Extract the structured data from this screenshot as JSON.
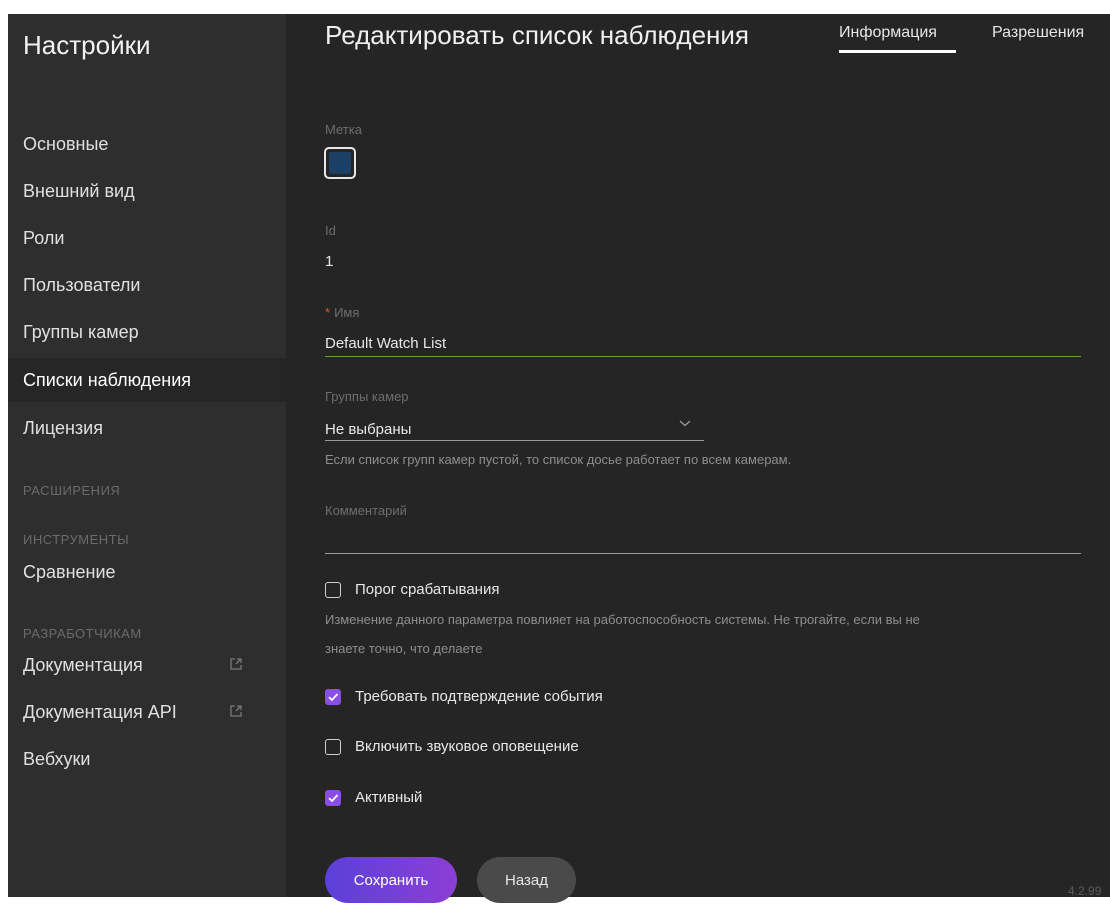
{
  "sidebar": {
    "title": "Настройки",
    "items": [
      {
        "label": "Основные"
      },
      {
        "label": "Внешний вид"
      },
      {
        "label": "Роли"
      },
      {
        "label": "Пользователи"
      },
      {
        "label": "Группы камер"
      },
      {
        "label": "Списки наблюдения",
        "active": true
      },
      {
        "label": "Лицензия"
      }
    ],
    "section_extensions": "РАСШИРЕНИЯ",
    "section_tools": "ИНСТРУМЕНТЫ",
    "tools_items": [
      {
        "label": "Сравнение"
      }
    ],
    "section_developers": "РАЗРАБОТЧИКАМ",
    "dev_items": [
      {
        "label": "Документация",
        "icon": "external-link-icon"
      },
      {
        "label": "Документация API",
        "icon": "external-link-icon"
      },
      {
        "label": "Вебхуки"
      }
    ]
  },
  "header": {
    "title": "Редактировать список наблюдения",
    "tabs": [
      {
        "label": "Информация",
        "active": true
      },
      {
        "label": "Разрешения"
      }
    ]
  },
  "form": {
    "mark_label": "Метка",
    "mark_color": "#1c3f66",
    "id_label": "Id",
    "id_value": "1",
    "name_required_marker": "*",
    "name_label": "Имя",
    "name_value": "Default Watch List",
    "camera_groups_label": "Группы камер",
    "camera_groups_value": "Не выбраны",
    "camera_groups_hint": "Если список групп камер пустой, то список досье работает по всем камерам.",
    "comment_label": "Комментарий",
    "comment_value": "",
    "threshold_label": "Порог срабатывания",
    "threshold_checked": false,
    "threshold_hint_line1": "Изменение данного параметра повлияет на работоспособность системы. Не трогайте, если вы не",
    "threshold_hint_line2": "знаете точно, что делаете",
    "require_ack_label": "Требовать подтверждение события",
    "require_ack_checked": true,
    "sound_label": "Включить звуковое оповещение",
    "sound_checked": false,
    "active_label": "Активный",
    "active_checked": true
  },
  "actions": {
    "save_label": "Сохранить",
    "back_label": "Назад"
  },
  "version": "4.2.99",
  "colors": {
    "accent": "#8a4fe0",
    "valid_underline": "#63a63a",
    "required": "#e2572b"
  }
}
